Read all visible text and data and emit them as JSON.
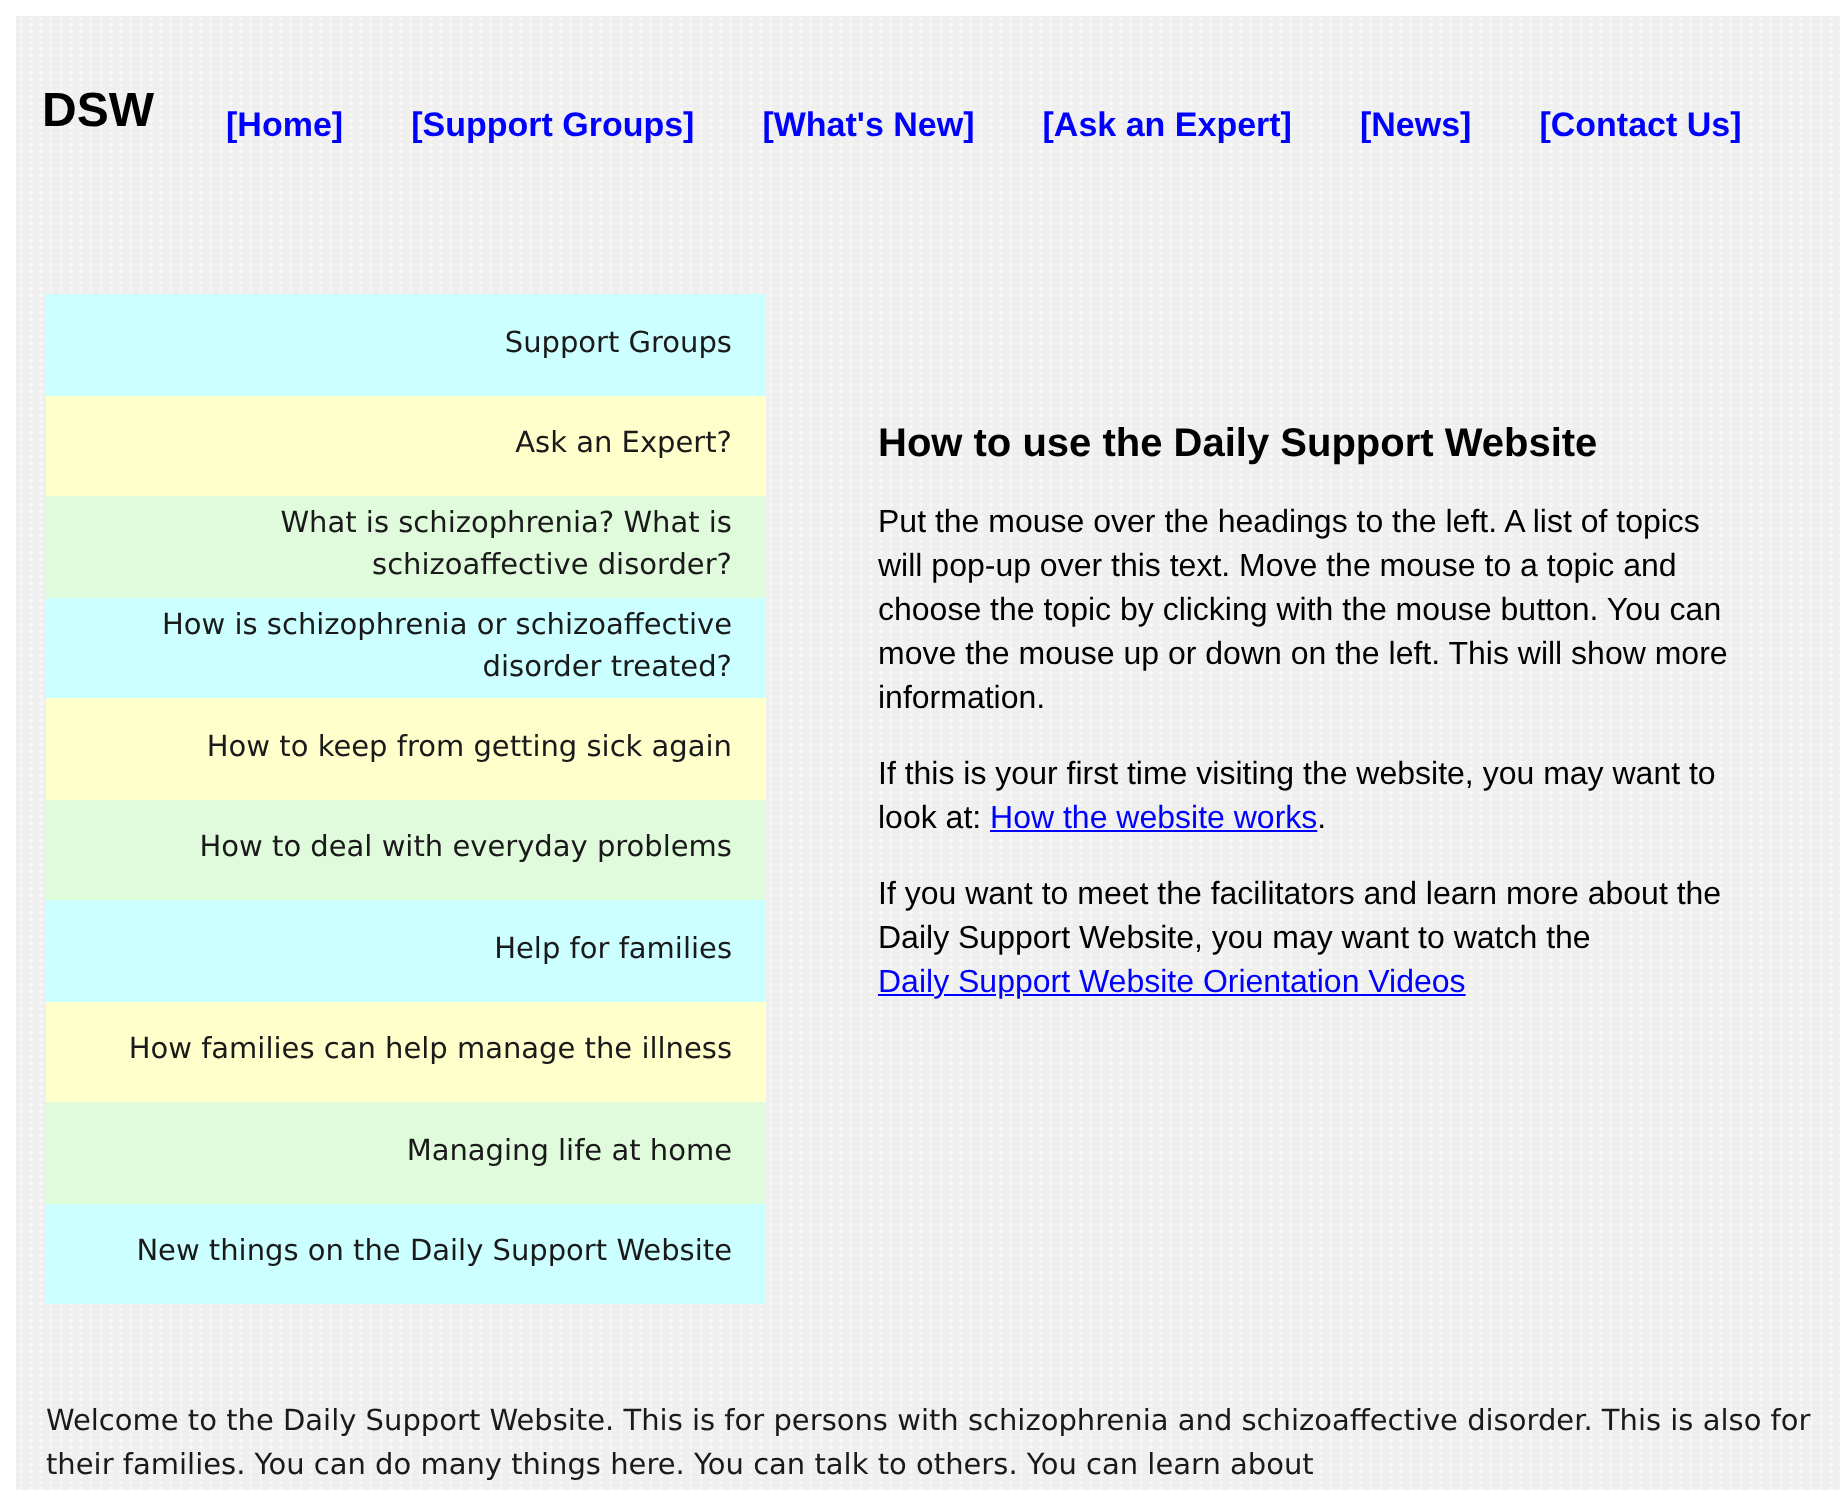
{
  "site_title": "DSW",
  "nav": [
    {
      "label": "[Home]"
    },
    {
      "label": "[Support Groups]"
    },
    {
      "label": "[What's New]"
    },
    {
      "label": "[Ask an Expert]"
    },
    {
      "label": "[News]"
    },
    {
      "label": "[Contact Us]"
    }
  ],
  "menu": [
    {
      "label": "Support Groups",
      "color": "#ccffff"
    },
    {
      "label": "Ask an Expert?",
      "color": "#ffffcc"
    },
    {
      "label": "What is schizophrenia? What is schizoaffective disorder?",
      "color": "#e0fadc"
    },
    {
      "label": "How is schizophrenia or schizoaffective disorder treated?",
      "color": "#ccffff"
    },
    {
      "label": "How to keep from getting sick again",
      "color": "#ffffcc"
    },
    {
      "label": "How to deal with everyday problems",
      "color": "#e0fadc"
    },
    {
      "label": "Help for families",
      "color": "#ccffff"
    },
    {
      "label": "How families can help manage the illness",
      "color": "#ffffcc"
    },
    {
      "label": "Managing life at home",
      "color": "#e0fadc"
    },
    {
      "label": "New things on the Daily Support Website",
      "color": "#ccffff"
    }
  ],
  "content": {
    "heading": "How to use the Daily Support Website",
    "paragraphs": [
      {
        "text": "Put the mouse over the headings to the left. A list of topics will pop-up over this text. Move the mouse to a topic and choose the topic by clicking with the mouse button. You can move the mouse up or down on the left. This will show more information."
      },
      {
        "text": "If this is your first time visiting the website, you may want to look at: ",
        "link": "How the website works",
        "after": "."
      },
      {
        "text": "If you want to meet the facilitators and learn more about the Daily Support Website, you may want to watch the ",
        "link": "Daily Support Website Orientation Videos"
      }
    ]
  },
  "welcome": "Welcome to the Daily Support Website. This is for persons with schizophrenia and schizoaffective disorder. This is also for their families. You can do many things here. You can talk to others. You can learn about"
}
